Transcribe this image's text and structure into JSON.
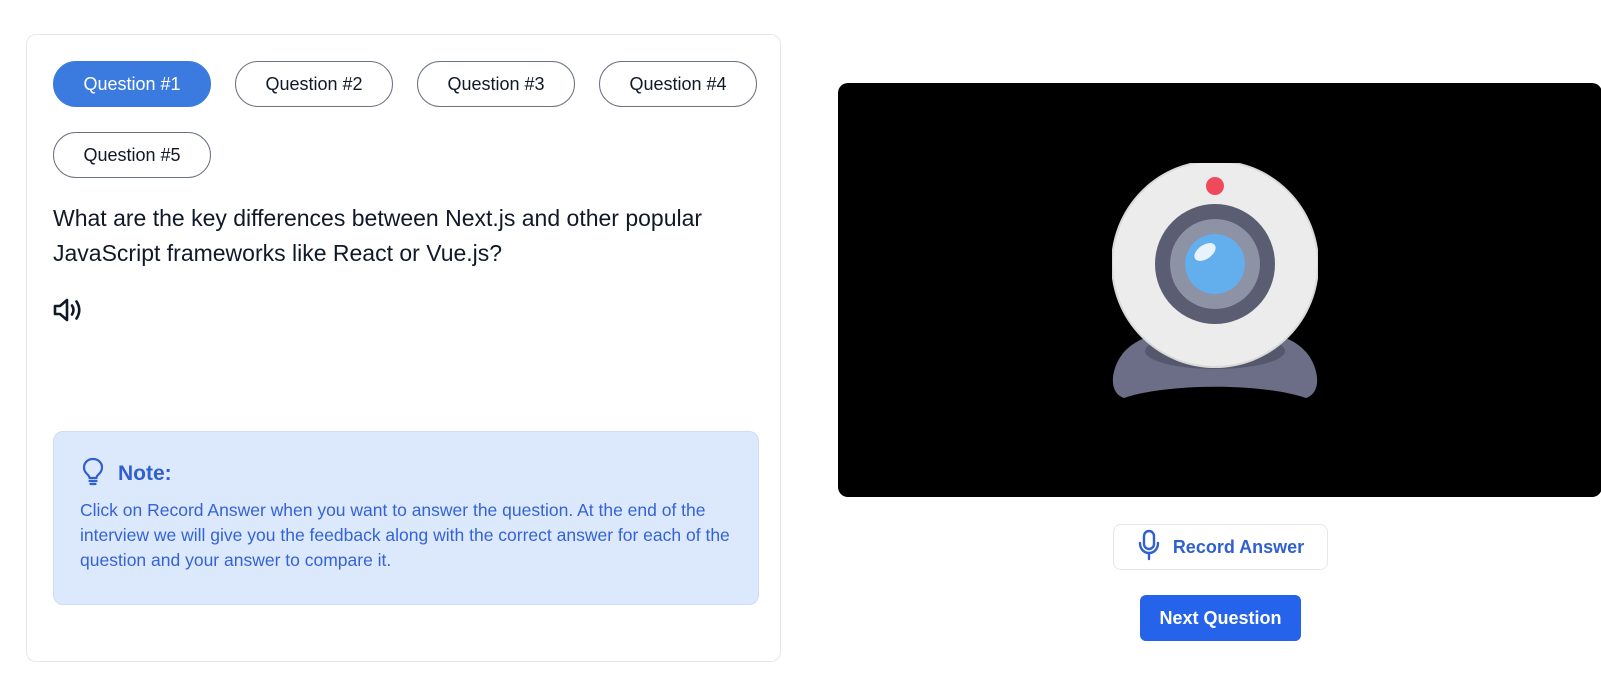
{
  "questions": {
    "tabs": [
      {
        "label": "Question #1",
        "active": true
      },
      {
        "label": "Question #2",
        "active": false
      },
      {
        "label": "Question #3",
        "active": false
      },
      {
        "label": "Question #4",
        "active": false
      },
      {
        "label": "Question #5",
        "active": false
      }
    ],
    "current_text": "What are the key differences between Next.js and other popular JavaScript frameworks like React or Vue.js?",
    "speaker_icon": "speaker-icon"
  },
  "note": {
    "icon": "lightbulb-icon",
    "title": "Note:",
    "body": "Click on Record Answer when you want to answer the question. At the end of the interview we will give you the feedback along with the correct answer for each of the question and your answer to compare it."
  },
  "camera": {
    "icon": "webcam-icon"
  },
  "actions": {
    "record_label": "Record Answer",
    "record_icon": "microphone-icon",
    "next_label": "Next Question"
  },
  "colors": {
    "accent": "#3b7be0",
    "primary_button": "#2563eb",
    "note_background": "#dce8fb",
    "note_text": "#3563d6",
    "camera_background": "#000000"
  }
}
